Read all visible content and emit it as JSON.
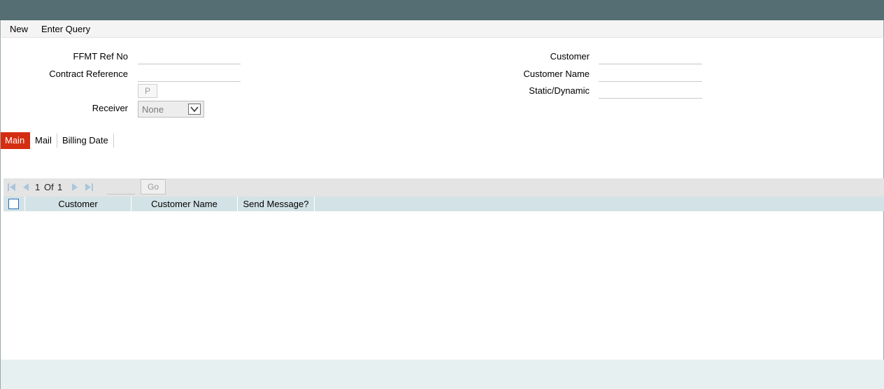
{
  "toolbar": {
    "new_label": "New",
    "enter_query_label": "Enter Query"
  },
  "form": {
    "ffmt_ref_no": {
      "label": "FFMT Ref No",
      "value": ""
    },
    "contract_reference": {
      "label": "Contract Reference",
      "value": ""
    },
    "p_button_label": "P",
    "receiver": {
      "label": "Receiver",
      "value": "None"
    },
    "customer": {
      "label": "Customer",
      "value": ""
    },
    "customer_name": {
      "label": "Customer Name",
      "value": ""
    },
    "static_dynamic": {
      "label": "Static/Dynamic",
      "value": ""
    }
  },
  "tabs": [
    {
      "label": "Main",
      "active": true
    },
    {
      "label": "Mail",
      "active": false
    },
    {
      "label": "Billing Date",
      "active": false
    }
  ],
  "pager": {
    "current": "1",
    "of_label": "Of",
    "total": "1",
    "go_label": "Go"
  },
  "grid": {
    "columns": [
      "Customer",
      "Customer Name",
      "Send Message?"
    ],
    "rows": []
  },
  "colors": {
    "titlebar": "#546e73",
    "active_tab": "#d42e12",
    "grid_header": "#d3e2e6",
    "pager_bg": "#e4e4e4",
    "footer": "#e6f0f1"
  },
  "icons": [
    "first-page-icon",
    "prev-page-icon",
    "next-page-icon",
    "last-page-icon",
    "dropdown-arrow-icon",
    "checkbox-icon"
  ]
}
